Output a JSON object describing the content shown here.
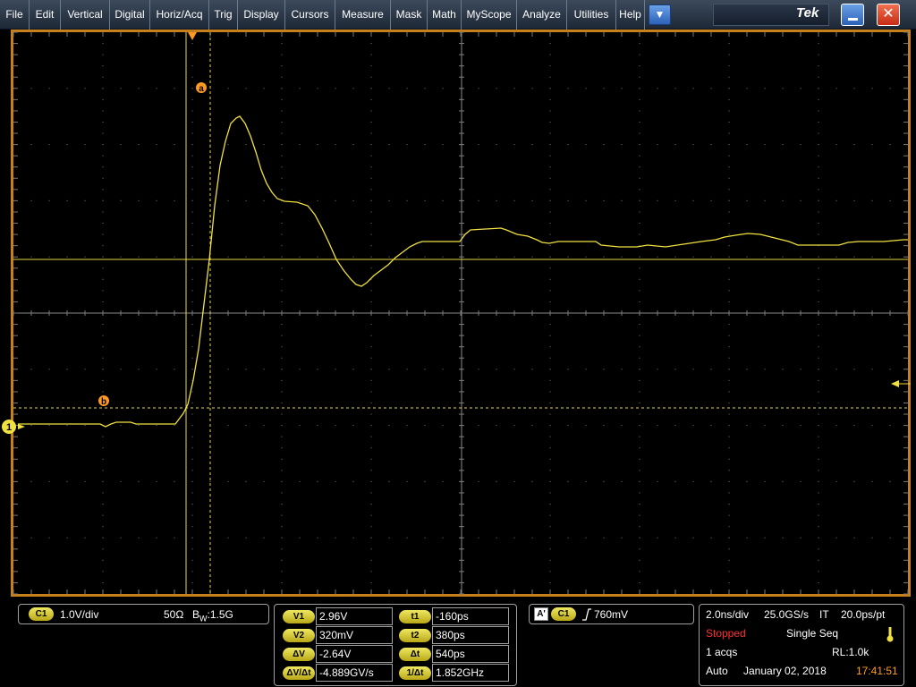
{
  "menu": {
    "items": [
      "File",
      "Edit",
      "Vertical",
      "Digital",
      "Horiz/Acq",
      "Trig",
      "Display",
      "Cursors",
      "Measure",
      "Mask",
      "Math",
      "MyScope",
      "Analyze",
      "Utilities",
      "Help"
    ],
    "dropdown_icon": "▼",
    "brand": "Tek",
    "minimize_icon": "minimize-icon",
    "close_icon": "✕"
  },
  "display": {
    "cursor_a_label": "a",
    "cursor_b_label": "b",
    "channel_marker": "1",
    "trace_color": "#f0e040",
    "cursor_color": "#e8d840",
    "grid_color": "#7a7a7a",
    "frame_color": "#c8801a"
  },
  "channel_panel": {
    "badge": "C1",
    "scale": "1.0V/div",
    "impedance": "50Ω",
    "bandwidth_prefix": "B",
    "bandwidth_sub": "W",
    "bandwidth_value": ":1.5G"
  },
  "cursor_readout": {
    "v1_label": "V1",
    "v1_value": "2.96V",
    "v2_label": "V2",
    "v2_value": "320mV",
    "dv_label": "ΔV",
    "dv_value": "-2.64V",
    "dvdt_label": "ΔV/Δt",
    "dvdt_value": "-4.889GV/s",
    "t1_label": "t1",
    "t1_value": "-160ps",
    "t2_label": "t2",
    "t2_value": "380ps",
    "dt_label": "Δt",
    "dt_value": "540ps",
    "invdt_label": "1/Δt",
    "invdt_value": "1.852GHz"
  },
  "trigger_panel": {
    "trig_badge": "A'",
    "channel_badge": "C1",
    "level": "760mV"
  },
  "acq_panel": {
    "timebase": "2.0ns/div",
    "sample_rate": "25.0GS/s",
    "mode": "IT",
    "resolution": "20.0ps/pt",
    "state": "Stopped",
    "run_mode": "Single Seq",
    "acqs": "1 acqs",
    "record_length": "RL:1.0k",
    "trigger_mode": "Auto",
    "date": "January 02, 2018",
    "time": "17:41:51"
  }
}
